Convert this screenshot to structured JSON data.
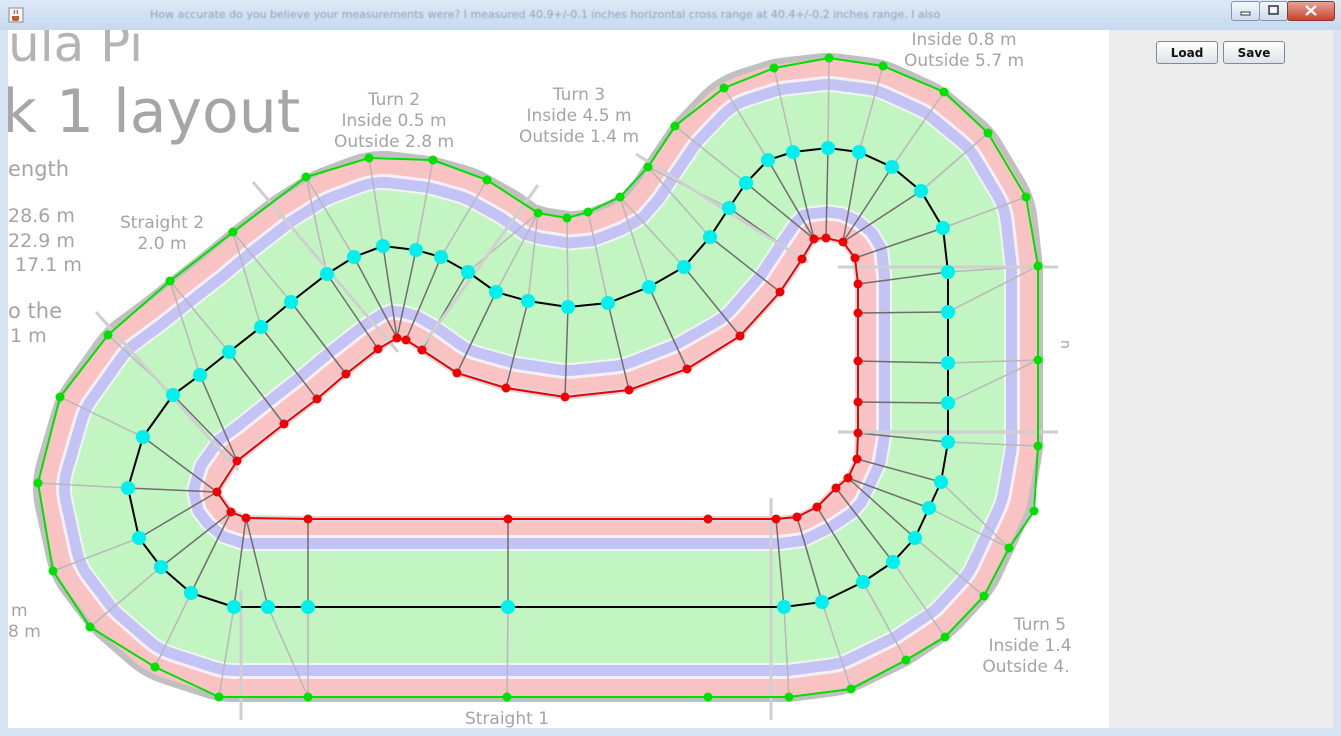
{
  "window": {
    "title": "How accurate do you believe your measurements were? I measured 40.9+/-0.1 inches horizontal cross range at 40.4+/-0.2 inches range. I also",
    "icons": {
      "app": "java-cup-icon",
      "minimize": "minimize-icon",
      "maximize": "maximize-icon",
      "close": "close-icon"
    }
  },
  "toolbar": {
    "load_label": "Load",
    "save_label": "Save"
  },
  "canvas": {
    "title_line1": "ula Pi",
    "title_line2": "k 1 layout",
    "length_label": "ength",
    "length_values": [
      "28.6 m",
      "22.9 m",
      "17.1 m"
    ],
    "note_line1": "o the",
    "note_line2": ".1 m",
    "bottom_left_line1": "m",
    "bottom_left_line2": "8 m",
    "right_edge_label": "n",
    "straight2": {
      "name": "Straight 2",
      "length": "2.0 m"
    },
    "turn2": {
      "name": "Turn 2",
      "inside": "Inside 0.5 m",
      "outside": "Outside 2.8 m"
    },
    "turn3": {
      "name": "Turn 3",
      "inside": "Inside 4.5 m",
      "outside": "Outside 1.4 m"
    },
    "turn4": {
      "inside": "Inside 0.8 m",
      "outside": "Outside 5.7 m"
    },
    "turn5": {
      "name": "Turn 5",
      "inside": "Inside 1.4",
      "outside": "Outside 4."
    },
    "straight1": {
      "name": "Straight 1"
    }
  },
  "colors": {
    "outer_band": "#f9c3c3",
    "middle_band": "#c3c3f5",
    "inner_band": "#c3f5c3",
    "border_gray": "#c0c0c0",
    "outer_points": "#00e000",
    "center_points": "#00f0f0",
    "inner_points": "#f00000",
    "label_gray": "#a0a0a0"
  }
}
